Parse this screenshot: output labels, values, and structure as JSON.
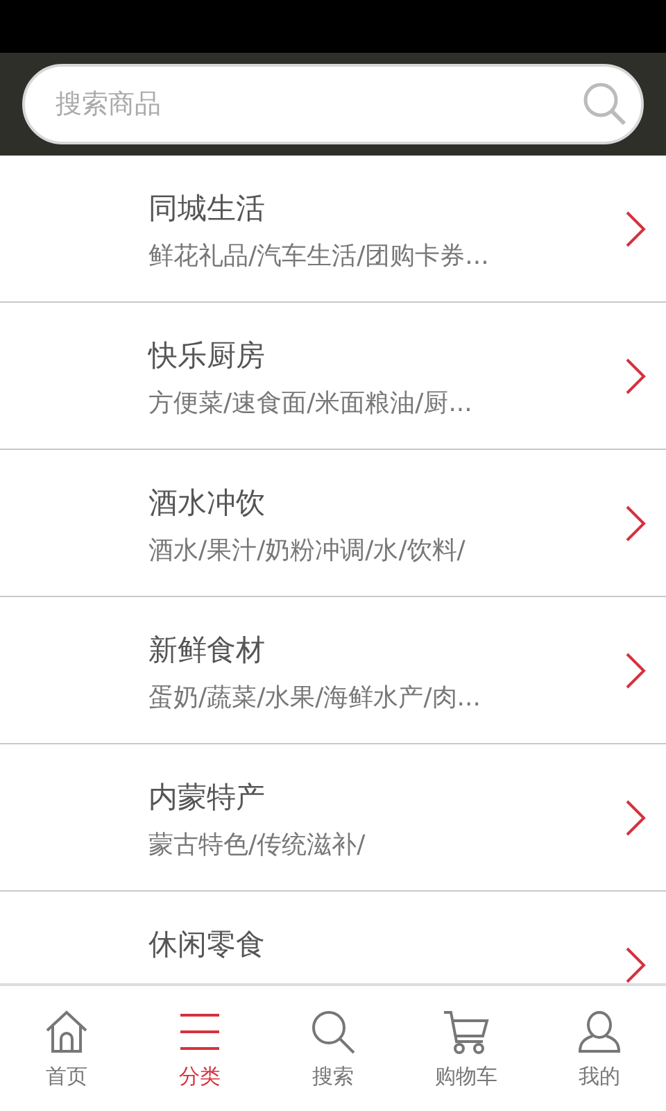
{
  "search": {
    "placeholder": "搜索商品"
  },
  "categories": [
    {
      "title": "同城生活",
      "subtitle": "鲜花礼品/汽车生活/团购卡券..."
    },
    {
      "title": "快乐厨房",
      "subtitle": "方便菜/速食面/米面粮油/厨..."
    },
    {
      "title": "酒水冲饮",
      "subtitle": "酒水/果汁/奶粉冲调/水/饮料/"
    },
    {
      "title": "新鲜食材",
      "subtitle": "蛋奶/蔬菜/水果/海鲜水产/肉..."
    },
    {
      "title": "内蒙特产",
      "subtitle": "蒙古特色/传统滋补/"
    },
    {
      "title": "休闲零食"
    }
  ],
  "tabs": [
    {
      "kind": "home",
      "label": "首页",
      "selected": false
    },
    {
      "kind": "category",
      "label": "分类",
      "selected": true
    },
    {
      "kind": "search",
      "label": "搜索",
      "selected": false
    },
    {
      "kind": "cart",
      "label": "购物车",
      "selected": false
    },
    {
      "kind": "user",
      "label": "我的",
      "selected": false
    }
  ]
}
